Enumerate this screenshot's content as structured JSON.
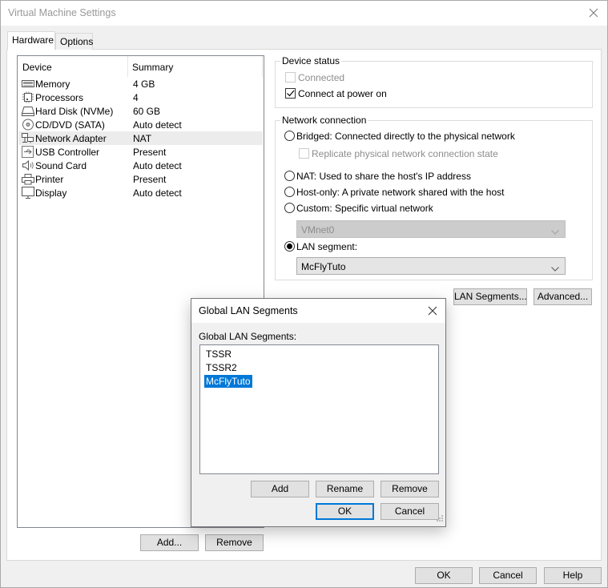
{
  "window": {
    "title": "Virtual Machine Settings",
    "close_icon": "close-icon"
  },
  "tabs": [
    {
      "label": "Hardware",
      "active": true
    },
    {
      "label": "Options",
      "active": false
    }
  ],
  "device_list": {
    "headers": {
      "device": "Device",
      "summary": "Summary"
    },
    "rows": [
      {
        "icon": "memory-icon",
        "name": "Memory",
        "summary": "4 GB"
      },
      {
        "icon": "processor-icon",
        "name": "Processors",
        "summary": "4"
      },
      {
        "icon": "hard-disk-icon",
        "name": "Hard Disk (NVMe)",
        "summary": "60 GB"
      },
      {
        "icon": "cd-dvd-icon",
        "name": "CD/DVD (SATA)",
        "summary": "Auto detect"
      },
      {
        "icon": "network-adapter-icon",
        "name": "Network Adapter",
        "summary": "NAT",
        "selected": true
      },
      {
        "icon": "usb-icon",
        "name": "USB Controller",
        "summary": "Present"
      },
      {
        "icon": "sound-icon",
        "name": "Sound Card",
        "summary": "Auto detect"
      },
      {
        "icon": "printer-icon",
        "name": "Printer",
        "summary": "Present"
      },
      {
        "icon": "display-icon",
        "name": "Display",
        "summary": "Auto detect"
      }
    ],
    "add_label": "Add...",
    "remove_label": "Remove"
  },
  "device_status": {
    "label": "Device status",
    "connected": {
      "label": "Connected",
      "checked": false,
      "disabled": true
    },
    "connect_at_power_on": {
      "label": "Connect at power on",
      "checked": true
    }
  },
  "network_connection": {
    "label": "Network connection",
    "bridged": {
      "label": "Bridged: Connected directly to the physical network",
      "selected": false
    },
    "replicate": {
      "label": "Replicate physical network connection state",
      "checked": false,
      "disabled": true
    },
    "nat": {
      "label": "NAT: Used to share the host's IP address",
      "selected": false
    },
    "host_only": {
      "label": "Host-only: A private network shared with the host",
      "selected": false
    },
    "custom": {
      "label": "Custom: Specific virtual network",
      "selected": false
    },
    "custom_select": {
      "value": "VMnet0",
      "disabled": true
    },
    "lan_segment": {
      "label": "LAN segment:",
      "selected": true
    },
    "lan_select": {
      "value": "McFlyTuto"
    }
  },
  "right_buttons": {
    "lan_segments": "LAN Segments...",
    "advanced": "Advanced..."
  },
  "footer": {
    "ok": "OK",
    "cancel": "Cancel",
    "help": "Help"
  },
  "modal": {
    "title": "Global LAN Segments",
    "list_label": "Global LAN Segments:",
    "items": [
      {
        "label": "TSSR",
        "selected": false
      },
      {
        "label": "TSSR2",
        "selected": false
      },
      {
        "label": "McFlyTuto",
        "selected": true
      }
    ],
    "add": "Add",
    "rename": "Rename",
    "remove": "Remove",
    "ok": "OK",
    "cancel": "Cancel"
  },
  "colors": {
    "accent": "#0078d7",
    "selected_row": "#ececec",
    "disabled_text": "#8d8d8d"
  }
}
